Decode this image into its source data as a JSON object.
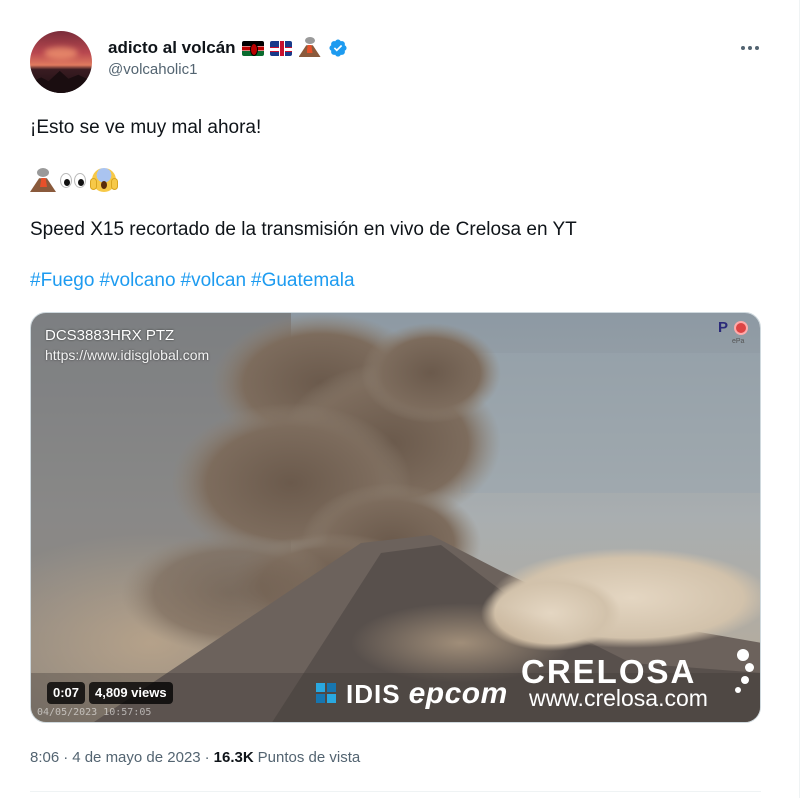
{
  "author": {
    "display_name": "adicto al volcán",
    "handle": "@volcaholic1",
    "verified": true,
    "name_emojis": [
      "kenya-flag",
      "uk-flag",
      "volcano"
    ]
  },
  "menu": {
    "more_icon": "more-horizontal-icon"
  },
  "tweet": {
    "line1": "¡Esto se ve muy mal ahora!",
    "emoji_line": [
      "volcano",
      "eyes",
      "face-screaming-in-fear"
    ],
    "line3": "Speed X15 recortado de la transmisión en vivo de Crelosa en YT",
    "hashtags": [
      "#Fuego",
      "#volcano",
      "#volcan",
      "#Guatemala"
    ]
  },
  "media": {
    "camera_id": "DCS3883HRX PTZ",
    "camera_url": "https://www.idisglobal.com",
    "duration": "0:07",
    "views": "4,809 views",
    "overlay_timestamp": "04/05/2023 10:57:05",
    "watermark_idis": "IDIS",
    "watermark_epcom": "epcom",
    "watermark_crelosa": "CRELOSA",
    "watermark_crelosa_url": "www.crelosa.com"
  },
  "meta": {
    "time": "8:06",
    "separator": "·",
    "date": "4 de mayo de 2023",
    "view_count": "16.3K",
    "view_label": "Puntos de vista"
  },
  "colors": {
    "link": "#1d9bf0",
    "secondary_text": "#536471",
    "verified": "#1d9bf0"
  }
}
